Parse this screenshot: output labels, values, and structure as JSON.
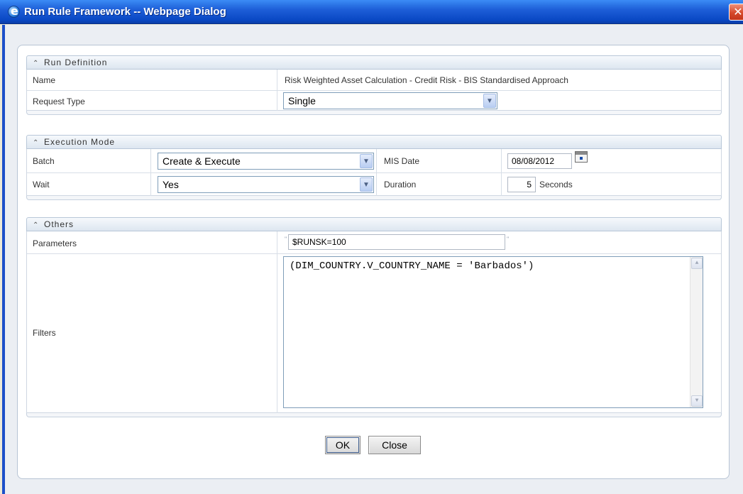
{
  "window": {
    "title": "Run Rule Framework -- Webpage Dialog",
    "close_glyph": "✕"
  },
  "run_definition": {
    "header": "Run Definition",
    "name_label": "Name",
    "name_value": "Risk Weighted Asset Calculation - Credit Risk - BIS Standardised Approach",
    "request_type_label": "Request Type",
    "request_type_value": "Single"
  },
  "execution_mode": {
    "header": "Execution Mode",
    "batch_label": "Batch",
    "batch_value": "Create & Execute",
    "mis_date_label": "MIS Date",
    "mis_date_value": "08/08/2012",
    "wait_label": "Wait",
    "wait_value": "Yes",
    "duration_label": "Duration",
    "duration_value": "5",
    "duration_unit": "Seconds"
  },
  "others": {
    "header": "Others",
    "parameters_label": "Parameters",
    "parameters_value": "$RUNSK=100",
    "filters_label": "Filters",
    "filters_value": "(DIM_COUNTRY.V_COUNTRY_NAME = 'Barbados')"
  },
  "buttons": {
    "ok": "OK",
    "close": "Close"
  },
  "icons": {
    "collapse": "chevron-double-up-icon",
    "dropdown": "chevron-down-icon",
    "calendar": "calendar-icon",
    "browser": "ie-icon"
  }
}
